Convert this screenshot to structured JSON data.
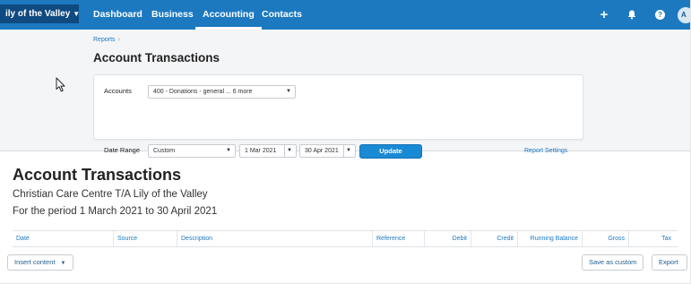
{
  "nav": {
    "org_name": "ily of the Valley",
    "items": [
      "Dashboard",
      "Business",
      "Accounting",
      "Contacts"
    ],
    "active": "Accounting",
    "plus_icon": "+",
    "bell_icon": "bell-icon",
    "help_icon": "?",
    "avatar_initial": "A"
  },
  "header": {
    "breadcrumb": "Reports",
    "breadcrumb_sep": "›",
    "title": "Account Transactions"
  },
  "filters": {
    "accounts_label": "Accounts",
    "accounts_value": "400 - Donations - general ... 6 more",
    "date_range_label": "Date Range",
    "date_range_value": "Custom",
    "from_date": "1 Mar 2021",
    "to_date": "30 Apr 2021",
    "update_label": "Update",
    "report_settings_label": "Report Settings"
  },
  "report": {
    "title": "Account Transactions",
    "organisation": "Christian Care Centre T/A Lily of the Valley",
    "period": "For the period 1 March 2021 to 30 April 2021",
    "columns": [
      "Date",
      "Source",
      "Description",
      "Reference",
      "Debit",
      "Credit",
      "Running Balance",
      "Gross",
      "Tax"
    ]
  },
  "footer": {
    "insert_content_label": "Insert content",
    "save_as_custom_label": "Save as custom",
    "export_label": "Export"
  },
  "colors": {
    "nav_bg": "#1c79c0",
    "link": "#1c79c0",
    "primary_button": "#1a8ad4"
  }
}
